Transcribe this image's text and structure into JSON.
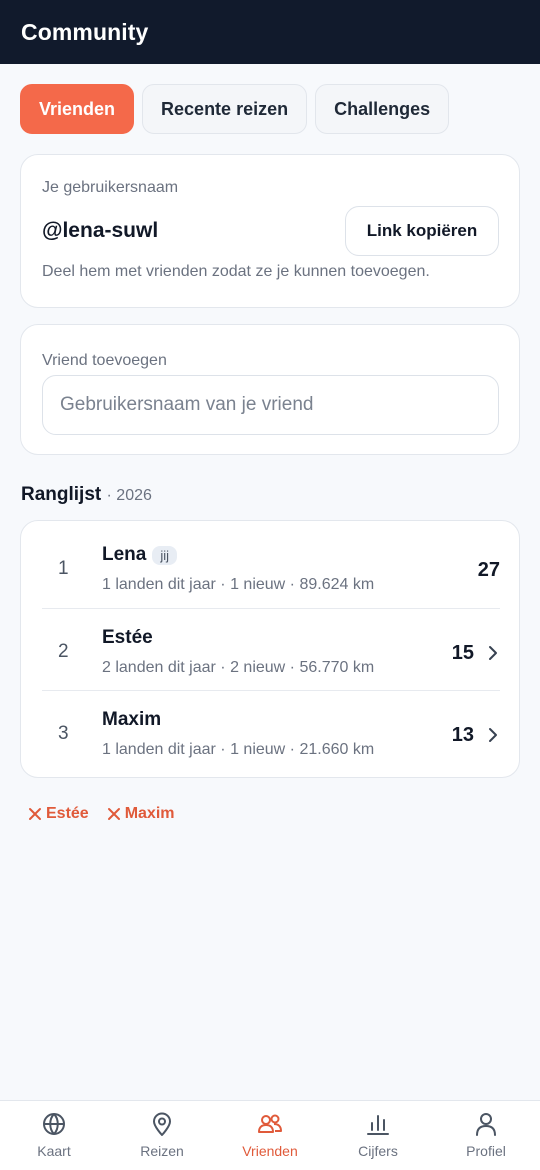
{
  "header": {
    "title": "Community"
  },
  "tabs": [
    {
      "label": "Vrienden",
      "active": true
    },
    {
      "label": "Recente reizen",
      "active": false
    },
    {
      "label": "Challenges",
      "active": false
    }
  ],
  "user_card": {
    "label": "Je gebruikersnaam",
    "username": "@lena-suwl",
    "copy_label": "Link kopiëren",
    "hint": "Deel hem met vrienden zodat ze je kunnen toevoegen."
  },
  "add_friend": {
    "label": "Vriend toevoegen",
    "placeholder": "Gebruikersnaam van je vriend",
    "value": ""
  },
  "leaderboard": {
    "title": "Ranglijst",
    "year": "· 2026",
    "rows": [
      {
        "rank": "1",
        "name": "Lena",
        "badge": "jij",
        "meta": "1 landen dit jaar · 1 nieuw · 89.624 km",
        "score": "27"
      },
      {
        "rank": "2",
        "name": "Estée",
        "meta": "2 landen dit jaar · 2 nieuw · 56.770 km",
        "score": "15"
      },
      {
        "rank": "3",
        "name": "Maxim",
        "meta": "1 landen dit jaar · 1 nieuw · 21.660 km",
        "score": "13"
      }
    ]
  },
  "remove_buttons": [
    {
      "label": "Estée"
    },
    {
      "label": "Maxim"
    }
  ],
  "bottom_nav": [
    {
      "label": "Kaart",
      "icon": "globe-icon"
    },
    {
      "label": "Reizen",
      "icon": "map-pin-icon"
    },
    {
      "label": "Vrienden",
      "icon": "users-icon",
      "active": true
    },
    {
      "label": "Cijfers",
      "icon": "bar-chart-icon"
    },
    {
      "label": "Profiel",
      "icon": "user-icon"
    }
  ],
  "colors": {
    "accent": "#f4694a",
    "header_bg": "#111a2c",
    "remove": "#e05a3a",
    "background": "#f7f9fc"
  }
}
